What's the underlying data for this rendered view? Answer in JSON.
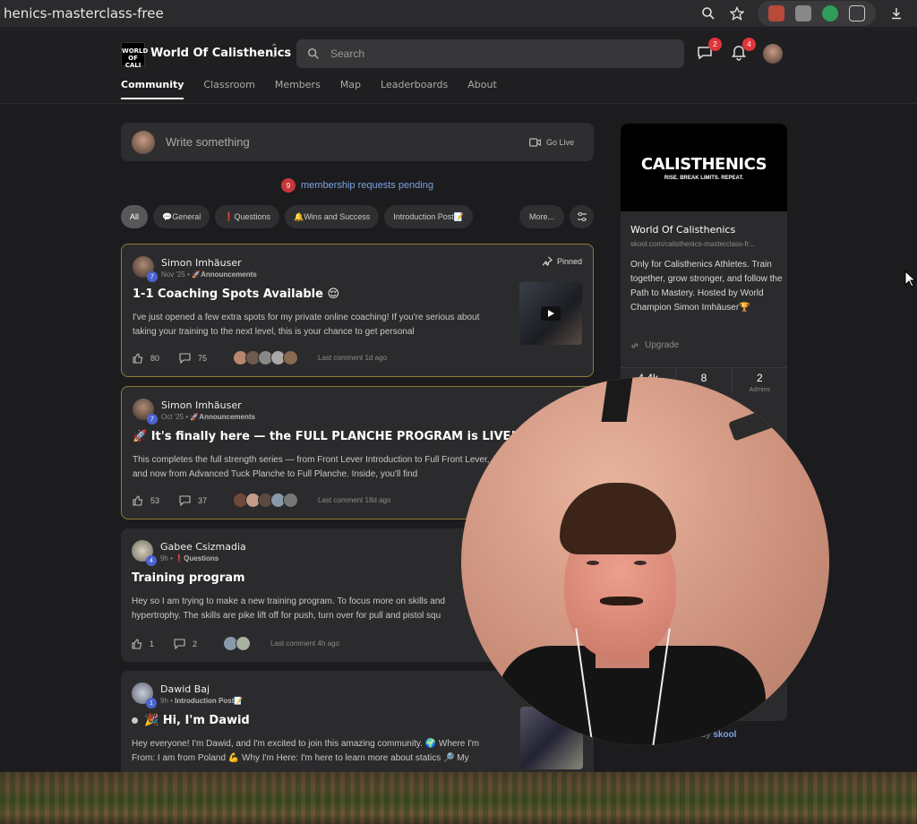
{
  "browser": {
    "url_text": "henics-masterclass-free"
  },
  "header": {
    "logo_text": "WORLD OF CALI",
    "group_name": "World Of Calisthenics",
    "search_placeholder": "Search",
    "chat_badge": "2",
    "notif_badge": "4"
  },
  "tabs": [
    "Community",
    "Classroom",
    "Members",
    "Map",
    "Leaderboards",
    "About"
  ],
  "composer": {
    "placeholder": "Write something",
    "go_live": "Go Live"
  },
  "pending": {
    "count": "9",
    "text": "membership requests pending"
  },
  "filters": {
    "chips": [
      "All",
      "💬General",
      "❗Questions",
      "🔔Wins and Success",
      "Introduction Post📝"
    ],
    "more": "More..."
  },
  "posts": [
    {
      "author": "Simon Imhäuser",
      "level": "7",
      "date": "Nov '25",
      "category": "🚀Announcements",
      "title": "1-1 Coaching Spots Available 😌",
      "body": "I've just opened a few extra spots for my private online coaching! If you're serious about taking your training to the next level, this is your chance to get personal",
      "likes": "80",
      "comments": "75",
      "last_comment": "Last comment 1d ago",
      "pinned": "Pinned"
    },
    {
      "author": "Simon Imhäuser",
      "level": "7",
      "date": "Oct '25",
      "category": "🚀Announcements",
      "title": "🚀 It's finally here — the FULL PLANCHE PROGRAM is LIVE!",
      "body": "This completes the full strength series — from Front Lever Introduction to Full Front Lever, and now from Advanced Tuck Planche to Full Planche. Inside, you'll find",
      "likes": "53",
      "comments": "37",
      "last_comment": "Last comment 18d ago"
    },
    {
      "author": "Gabee Csizmadia",
      "level": "4",
      "date": "9h",
      "category": "❗Questions",
      "title": "Training program",
      "body": "Hey so I am trying to make a new training program. To focus more on skills and hypertrophy. The skills are pike lift off for push, turn over for pull and pistol squ",
      "likes": "1",
      "comments": "2",
      "last_comment": "Last comment 4h ago"
    },
    {
      "author": "Dawid Baj",
      "level": "1",
      "date": "9h",
      "category": "Introduction Post📝",
      "title": "🎉 Hi, I'm Dawid",
      "body": "Hey everyone! I'm Dawid, and I'm excited to join this amazing community. 🌍 Where I'm From: I am from Poland 💪 Why I'm Here: I'm here to learn more about statics 🔎 My"
    }
  ],
  "sidebar": {
    "banner_title": "CALISTHENICS",
    "banner_sub": "RISE. BREAK LIMITS. REPEAT.",
    "name": "World Of Calisthenics",
    "url": "skool.com/calisthenics-masterclass-fr...",
    "description": "Only for Calisthenics Athletes. Train together, grow stronger, and follow the Path to Mastery. Hosted by World Champion Simon Imhäuser🏆",
    "upgrade": "Upgrade",
    "stats": [
      {
        "value": "4.4k",
        "label": ""
      },
      {
        "value": "8",
        "label": ""
      },
      {
        "value": "2",
        "label": "Admins"
      }
    ]
  },
  "footer": {
    "powered": "by",
    "brand": "skool"
  }
}
